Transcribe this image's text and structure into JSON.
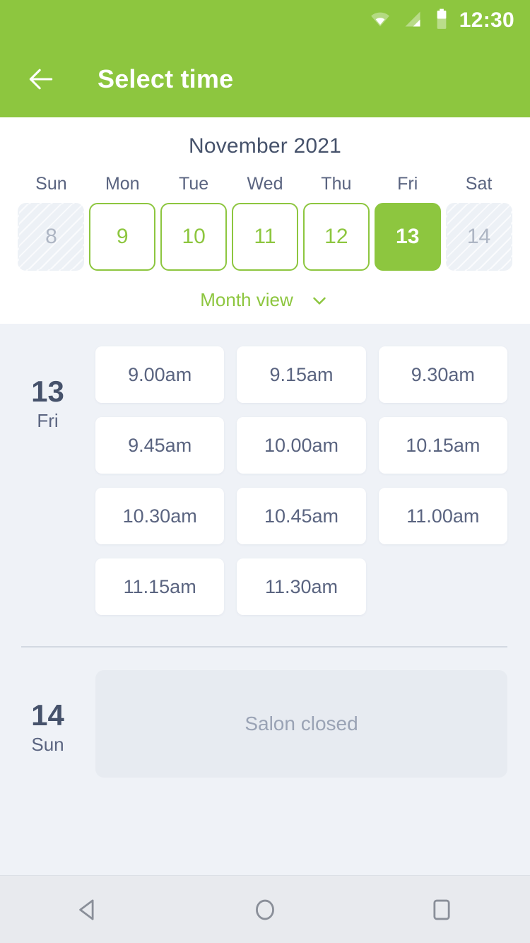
{
  "status_bar": {
    "time": "12:30",
    "icons": [
      "wifi-icon",
      "signal-icon",
      "battery-icon"
    ]
  },
  "app_bar": {
    "back_icon": "arrow-left-icon",
    "title": "Select time"
  },
  "calendar": {
    "month_title": "November 2021",
    "weekdays": [
      "Sun",
      "Mon",
      "Tue",
      "Wed",
      "Thu",
      "Fri",
      "Sat"
    ],
    "days": [
      {
        "num": "8",
        "state": "disabled"
      },
      {
        "num": "9",
        "state": "available"
      },
      {
        "num": "10",
        "state": "available"
      },
      {
        "num": "11",
        "state": "available"
      },
      {
        "num": "12",
        "state": "available"
      },
      {
        "num": "13",
        "state": "selected"
      },
      {
        "num": "14",
        "state": "disabled"
      }
    ],
    "month_view_label": "Month view",
    "month_view_icon": "chevron-down-icon"
  },
  "schedule": {
    "days": [
      {
        "num": "13",
        "dow": "Fri",
        "slots": [
          "9.00am",
          "9.15am",
          "9.30am",
          "9.45am",
          "10.00am",
          "10.15am",
          "10.30am",
          "10.45am",
          "11.00am",
          "11.15am",
          "11.30am"
        ]
      },
      {
        "num": "14",
        "dow": "Sun",
        "closed_label": "Salon closed"
      }
    ]
  },
  "nav_bar": {
    "back_icon": "nav-back-triangle-icon",
    "home_icon": "nav-home-circle-icon",
    "recents_icon": "nav-recents-square-icon"
  },
  "colors": {
    "brand_green": "#8DC63F",
    "text_dark": "#46526B",
    "text_muted": "#5A6480",
    "background": "#EFF2F7",
    "surface": "#FFFFFF",
    "closed_card": "#E7EBF1"
  }
}
